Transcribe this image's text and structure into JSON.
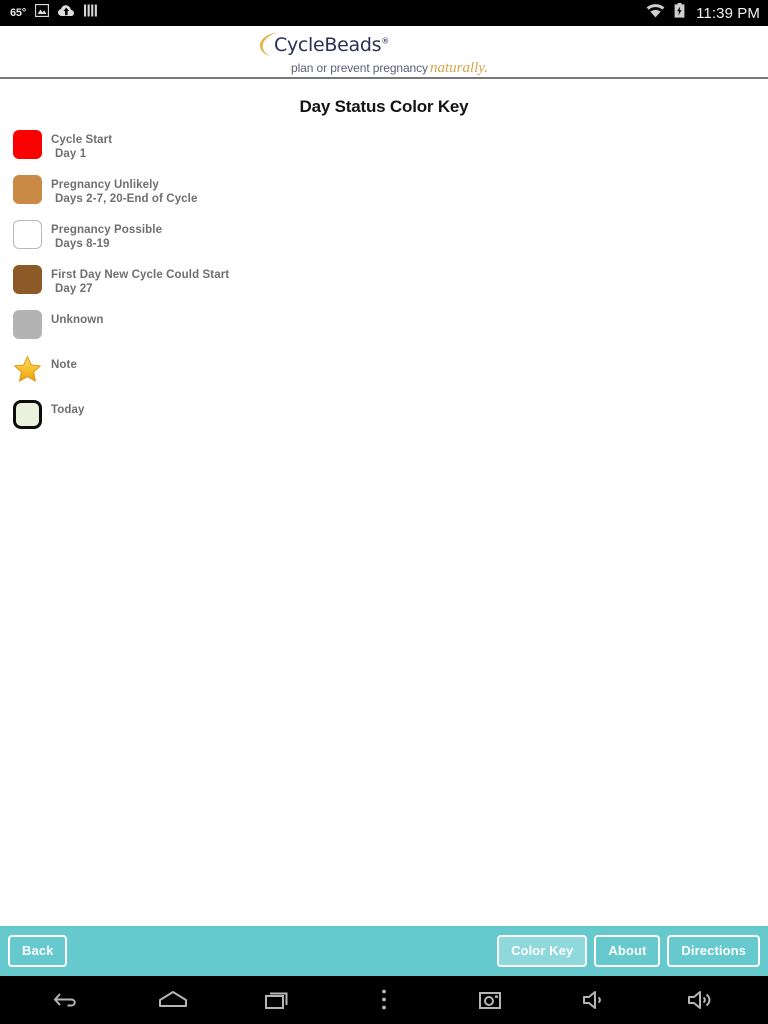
{
  "statusbar": {
    "temperature": "65°",
    "time": "11:39 PM",
    "icons_left": [
      "photo-icon",
      "cloud-upload-icon",
      "bars-icon"
    ],
    "icons_right": [
      "wifi-icon",
      "battery-charging-icon"
    ]
  },
  "header": {
    "brand": "CycleBeads",
    "trademark": "®",
    "tagline_plain": "plan or prevent pregnancy",
    "tagline_script": "naturally.",
    "brand_color": "#2b3154",
    "accent_color": "#d4a64a"
  },
  "main": {
    "title": "Day Status Color Key",
    "legend": [
      {
        "label": "Cycle Start",
        "sub": "Day 1",
        "color": "#fa0000",
        "swatch_kind": "filled"
      },
      {
        "label": "Pregnancy Unlikely",
        "sub": "Days 2-7, 20-End of Cycle",
        "color": "#c98a45",
        "swatch_kind": "filled"
      },
      {
        "label": "Pregnancy Possible",
        "sub": "Days 8-19",
        "color": "#ffffff",
        "swatch_kind": "outlined"
      },
      {
        "label": "First Day New Cycle Could Start",
        "sub": "Day 27",
        "color": "#8b5a27",
        "swatch_kind": "filled"
      },
      {
        "label": "Unknown",
        "sub": "",
        "color": "#b3b3b3",
        "swatch_kind": "filled"
      },
      {
        "label": "Note",
        "sub": "",
        "color": "#f5b524",
        "swatch_kind": "star"
      },
      {
        "label": "Today",
        "sub": "",
        "color": "#eaf1dc",
        "swatch_kind": "today"
      }
    ]
  },
  "toolbar": {
    "background": "#65c9cd",
    "back_label": "Back",
    "color_key_label": "Color Key",
    "about_label": "About",
    "directions_label": "Directions",
    "active_button": "Color Key"
  },
  "navbar": {
    "buttons": [
      "back-icon",
      "home-icon",
      "recents-icon",
      "overflow-menu-icon",
      "screenshot-camera-icon",
      "volume-down-icon",
      "volume-up-icon"
    ]
  }
}
